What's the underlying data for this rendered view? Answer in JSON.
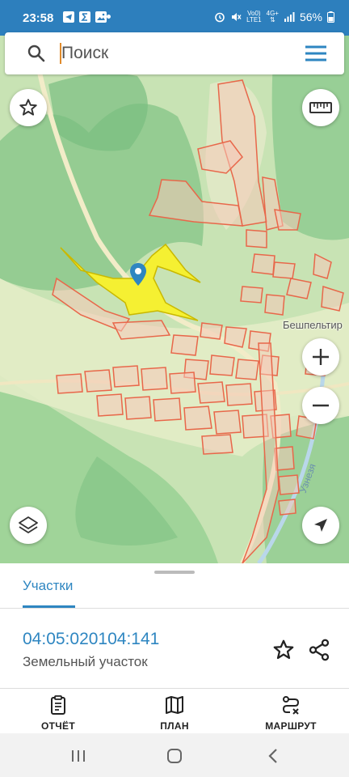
{
  "status": {
    "time": "23:58",
    "network_top": "Vo0)",
    "network_bottom": "LTE1",
    "net_type": "4G+",
    "battery": "56%"
  },
  "search": {
    "placeholder": "Поиск"
  },
  "map": {
    "place_label": "Бешпельтир",
    "road_label": "Узнезя"
  },
  "sheet": {
    "tab_label": "Участки",
    "parcel_number": "04:05:020104:141",
    "parcel_type": "Земельный участок"
  },
  "actions": [
    {
      "label": "ОТЧЁТ",
      "icon": "clipboard-icon"
    },
    {
      "label": "ПЛАН",
      "icon": "map-icon"
    },
    {
      "label": "МАРШРУТ",
      "icon": "route-icon"
    }
  ],
  "colors": {
    "accent": "#2e86c1",
    "status_bar": "#2d7fbd",
    "parcel_selected": "#f5f032",
    "parcel_outline": "#e8674a"
  }
}
